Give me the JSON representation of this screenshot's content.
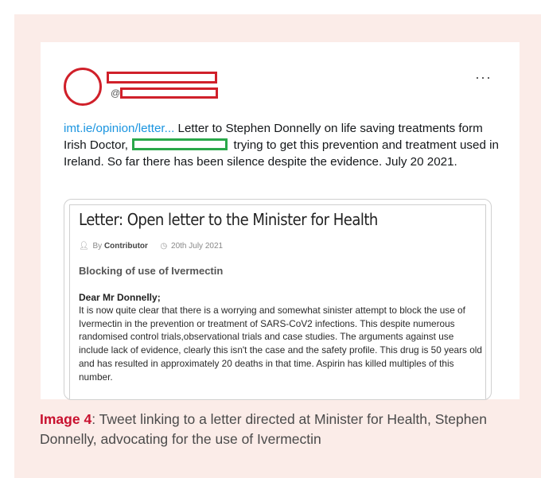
{
  "tweet": {
    "at_symbol": "@",
    "more_label": "···",
    "link_text": "imt.ie/opinion/letter...",
    "text_before_name": " Letter to Stephen Donnelly on life saving treatments form Irish Doctor, ",
    "text_after_name": " trying to get this prevention and treatment used in Ireland. So far there has been silence despite the evidence. July 20 2021."
  },
  "card": {
    "title": "Letter: Open letter to the Minister for Health",
    "author_prefix": "By",
    "author": "Contributor",
    "date": "20th July 2021",
    "section_heading": "Blocking of use of Ivermectin",
    "greeting": "Dear Mr Donnelly;",
    "body": "It is now quite clear that there is a worrying and somewhat sinister attempt to block the use of Ivermectin in the prevention or treatment of SARS-CoV2 infections. This despite numerous randomised control trials,observational trials and case studies. The arguments against use include lack of evidence, clearly this isn't the case and the safety profile. This drug is 50 years old and has resulted in approximately 20 deaths in that time. Aspirin has killed multiples of this number."
  },
  "caption": {
    "label": "Image 4",
    "text": ": Tweet linking to a letter directed at Minister for Health, Stephen Donnelly, advocating for the use of Ivermectin"
  },
  "icons": {
    "author": "person-icon",
    "date": "clock-icon"
  },
  "colors": {
    "panel_background": "#fbece8",
    "redaction_red": "#d0202a",
    "redaction_green": "#2aa84a",
    "link_blue": "#1b95e0",
    "caption_label": "#c8102e"
  }
}
